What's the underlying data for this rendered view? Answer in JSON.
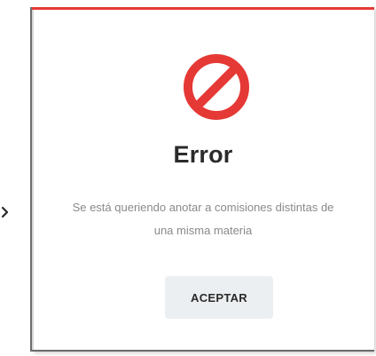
{
  "dialog": {
    "title": "Error",
    "message": "Se está queriendo anotar a comisiones distintas de una misma materia",
    "accept_label": "ACEPTAR",
    "icon": "prohibited-icon"
  },
  "side_arrow": {
    "icon": "chevron-right-icon"
  },
  "colors": {
    "accent_red": "#e53935",
    "top_border": "#e53935",
    "title_text": "#2b2b2b",
    "message_text": "#8a8a8a",
    "button_bg": "#eceff1"
  }
}
